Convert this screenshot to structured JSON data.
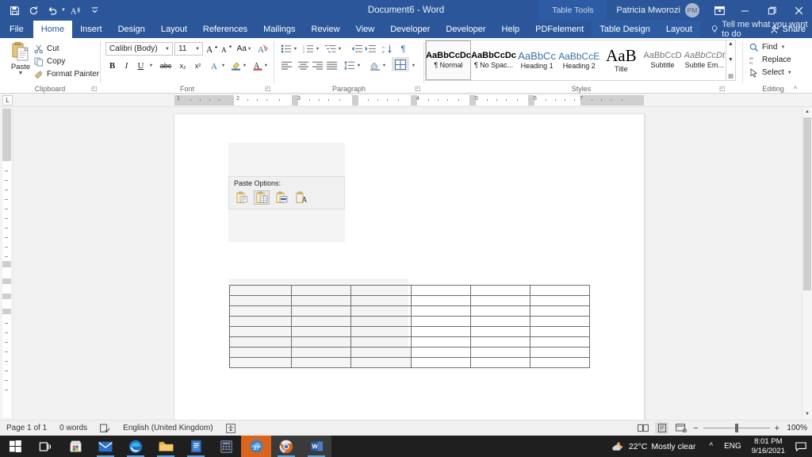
{
  "titlebar": {
    "document_title": "Document6  -  Word",
    "quick_access": [
      {
        "name": "save-icon",
        "label": "Save"
      },
      {
        "name": "repeat-icon",
        "label": "Repeat"
      },
      {
        "name": "undo-icon",
        "label": "Undo"
      },
      {
        "name": "read-aloud-icon",
        "label": "Read Aloud"
      },
      {
        "name": "customize-qat-icon",
        "label": "Customize Quick Access Toolbar"
      }
    ],
    "contextual_tab_group": "Table Tools",
    "user_name": "Patricia Mworozi",
    "user_initials": "PM",
    "ribbon_display_options": "Ribbon Display Options",
    "minimize": "Minimize",
    "restore": "Restore Down",
    "close": "Close"
  },
  "ribbon": {
    "tabs": [
      {
        "label": "File",
        "active": false
      },
      {
        "label": "Home",
        "active": true
      },
      {
        "label": "Insert",
        "active": false
      },
      {
        "label": "Design",
        "active": false
      },
      {
        "label": "Layout",
        "active": false
      },
      {
        "label": "References",
        "active": false
      },
      {
        "label": "Mailings",
        "active": false
      },
      {
        "label": "Review",
        "active": false
      },
      {
        "label": "View",
        "active": false
      },
      {
        "label": "Developer",
        "active": false
      },
      {
        "label": "Developer",
        "active": false
      },
      {
        "label": "Help",
        "active": false
      },
      {
        "label": "PDFelement",
        "active": false
      }
    ],
    "contextual_tabs": [
      {
        "label": "Table Design"
      },
      {
        "label": "Layout"
      }
    ],
    "tell_me": "Tell me what you want to do",
    "share": "Share",
    "clipboard": {
      "group_label": "Clipboard",
      "paste_label": "Paste",
      "cut_label": "Cut",
      "copy_label": "Copy",
      "format_painter_label": "Format Painter"
    },
    "font": {
      "group_label": "Font",
      "font_name": "Calibri (Body)",
      "font_size": "11",
      "grow_font": "Grow Font",
      "shrink_font": "Shrink Font",
      "change_case": "Aa",
      "clear_formatting": "Clear All Formatting",
      "bold": "B",
      "italic": "I",
      "underline": "U",
      "strikethrough": "abc",
      "subscript": "x₂",
      "superscript": "x²",
      "text_effects": "Text Effects and Typography",
      "highlight": "Text Highlight Color",
      "font_color": "Font Color"
    },
    "paragraph": {
      "group_label": "Paragraph",
      "bullets": "Bullets",
      "numbering": "Numbering",
      "multilevel": "Multilevel List",
      "decrease_indent": "Decrease Indent",
      "increase_indent": "Increase Indent",
      "sort": "Sort",
      "show_marks": "¶",
      "align_left": "Align Left",
      "center": "Center",
      "align_right": "Align Right",
      "justify": "Justify",
      "line_spacing": "Line and Paragraph Spacing",
      "shading": "Shading",
      "borders": "Borders"
    },
    "styles": {
      "group_label": "Styles",
      "items": [
        {
          "preview": "AaBbCcDc",
          "name": "¶ Normal",
          "selected": true
        },
        {
          "preview": "AaBbCcDc",
          "name": "¶ No Spac...",
          "selected": false
        },
        {
          "preview": "AaBbCc",
          "name": "Heading 1",
          "selected": false
        },
        {
          "preview": "AaBbCcE",
          "name": "Heading 2",
          "selected": false
        },
        {
          "preview": "AaB",
          "name": "Title",
          "selected": false
        },
        {
          "preview": "AaBbCcD",
          "name": "Subtitle",
          "selected": false
        },
        {
          "preview": "AaBbCcDt",
          "name": "Subtle Em...",
          "selected": false
        }
      ]
    },
    "editing": {
      "group_label": "Editing",
      "find": "Find",
      "replace": "Replace",
      "select": "Select",
      "collapse_ribbon": "Collapse the Ribbon"
    }
  },
  "ruler": {
    "tab_stop_selector": "L",
    "numbers": [
      "1",
      "2",
      "3",
      "4",
      "5",
      "6",
      "7"
    ]
  },
  "document": {
    "paste_flyout": {
      "title": "Paste Options:",
      "options": [
        {
          "name": "keep-source-formatting-icon",
          "selected": false
        },
        {
          "name": "merge-formatting-icon",
          "selected": true
        },
        {
          "name": "picture-icon",
          "selected": false
        },
        {
          "name": "keep-text-only-icon",
          "selected": false
        }
      ]
    },
    "table": {
      "rows": 8,
      "columns": 6,
      "cells": [
        [
          "",
          "",
          "",
          "",
          "",
          ""
        ],
        [
          "",
          "",
          "",
          "",
          "",
          ""
        ],
        [
          "",
          "",
          "",
          "",
          "",
          ""
        ],
        [
          "",
          "",
          "",
          "",
          "",
          ""
        ],
        [
          "",
          "",
          "",
          "",
          "",
          ""
        ],
        [
          "",
          "",
          "",
          "",
          "",
          ""
        ],
        [
          "",
          "",
          "",
          "",
          "",
          ""
        ],
        [
          "",
          "",
          "",
          "",
          "",
          ""
        ]
      ]
    }
  },
  "statusbar": {
    "page": "Page 1 of 1",
    "words": "0 words",
    "proofing_icon": "proofing-errors-icon",
    "language": "English (United Kingdom)",
    "accessibility_icon": "accessibility-checker-icon",
    "views": [
      {
        "name": "read-mode-view-icon",
        "active": false
      },
      {
        "name": "print-layout-view-icon",
        "active": true
      },
      {
        "name": "web-layout-view-icon",
        "active": false
      }
    ],
    "zoom_out": "−",
    "zoom_in": "+",
    "zoom_level": "100%"
  },
  "taskbar": {
    "items": [
      {
        "name": "start-button-icon",
        "label": "Start",
        "state": "idle"
      },
      {
        "name": "task-view-icon",
        "label": "Task View",
        "state": "idle"
      },
      {
        "name": "microsoft-store-icon",
        "label": "Microsoft Store",
        "state": "idle"
      },
      {
        "name": "mail-icon",
        "label": "Mail",
        "state": "running"
      },
      {
        "name": "microsoft-edge-icon",
        "label": "Microsoft Edge",
        "state": "running"
      },
      {
        "name": "file-explorer-icon",
        "label": "File Explorer",
        "state": "running"
      },
      {
        "name": "onedrive-folder-icon",
        "label": "Dictionary",
        "state": "running"
      },
      {
        "name": "calculator-icon",
        "label": "Calculator",
        "state": "idle"
      },
      {
        "name": "weather-app-icon",
        "label": "Weather",
        "state": "highlighted"
      },
      {
        "name": "google-chrome-icon",
        "label": "Google Chrome",
        "state": "running"
      },
      {
        "name": "microsoft-word-icon",
        "label": "Microsoft Word",
        "state": "active"
      }
    ],
    "tray": {
      "weather_temp": "22°C",
      "weather_desc": "Mostly clear",
      "weather_icon": "moon-cloud-icon",
      "show_hidden_icons": "^",
      "language": "ENG",
      "time": "8:01 PM",
      "date": "9/16/2021",
      "notifications_icon": "notification-center-icon"
    }
  },
  "colors": {
    "word_blue": "#2b579a",
    "contextual_blue": "#2e5ca4",
    "taskbar_dark": "#1f1f1f",
    "weather_orange": "#d9641e",
    "accent_underline": "#5ba3e0"
  }
}
